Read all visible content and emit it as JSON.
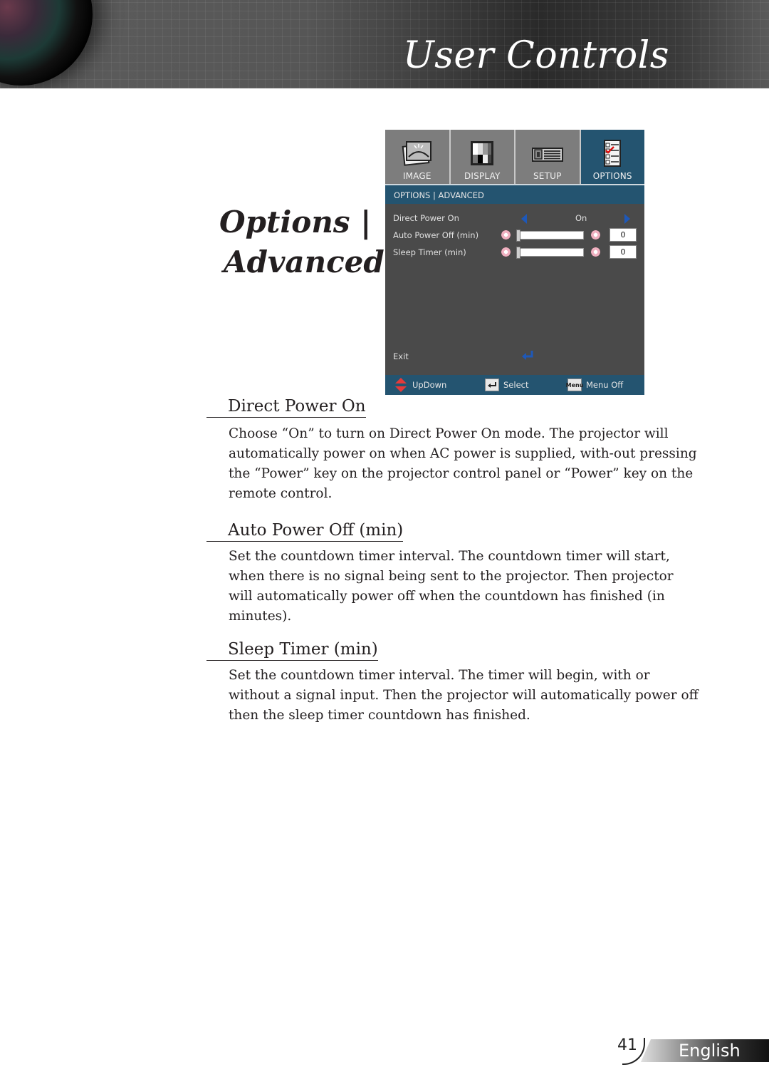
{
  "header": {
    "title": "User Controls"
  },
  "section_title": {
    "line1": "Options |",
    "line2": "Advanced"
  },
  "osd": {
    "tabs": [
      {
        "label": "IMAGE",
        "icon": "image-icon",
        "active": false
      },
      {
        "label": "DISPLAY",
        "icon": "display-icon",
        "active": false
      },
      {
        "label": "SETUP",
        "icon": "setup-projector-icon",
        "active": false
      },
      {
        "label": "OPTIONS",
        "icon": "options-checklist-icon",
        "active": true
      }
    ],
    "breadcrumb": "OPTIONS | ADVANCED",
    "rows": [
      {
        "label": "Direct Power On",
        "value": "On"
      },
      {
        "label": "Auto Power Off (min)",
        "value": "0",
        "slider_fraction": 0
      },
      {
        "label": "Sleep Timer (min)",
        "value": "0",
        "slider_fraction": 0
      }
    ],
    "exit_label": "Exit",
    "footer": {
      "updown": "UpDown",
      "select": "Select",
      "menu_key": "Menu",
      "menu_off": "Menu Off"
    },
    "colors": {
      "accent_blue": "#245470",
      "arrow_blue": "#1e58b8",
      "panel_gray": "#4a4a4a"
    }
  },
  "sections": [
    {
      "heading": "Direct Power On",
      "body": "Choose “On” to turn on Direct Power On mode. The projector will automatically power on when AC power is supplied, with-out pressing the “Power” key on the projector control panel or “Power” key on the remote control."
    },
    {
      "heading": "Auto Power Off (min)",
      "body": "Set the countdown timer interval. The countdown timer will start, when there is no signal being sent to the projector. Then projector will automatically power off when the countdown has finished (in minutes)."
    },
    {
      "heading": "Sleep Timer (min)",
      "body": "Set the countdown timer interval. The timer will begin, with or without a signal input. Then the projector will automatically power off then the sleep timer countdown has finished."
    }
  ],
  "page_footer": {
    "page_number": "41",
    "language": "English"
  }
}
